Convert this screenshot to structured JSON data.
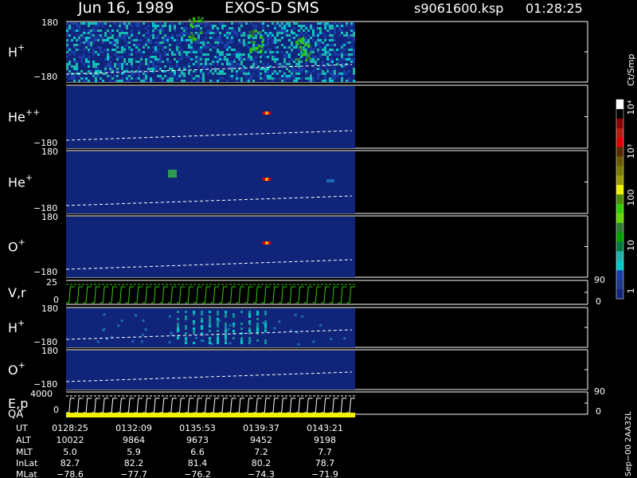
{
  "header": {
    "date": "Jun 16, 1989",
    "instrument": "EXOS-D SMS",
    "file": "s9061600.ksp",
    "time": "01:28:25"
  },
  "panels": [
    {
      "id": "h-plus",
      "ion": "H",
      "charge": "+",
      "ytop": "180",
      "ybot": "−180",
      "type": "spectrogram"
    },
    {
      "id": "he-plusplus",
      "ion": "He",
      "charge": "++",
      "ytop": "",
      "ybot": "−180",
      "type": "spectrogram"
    },
    {
      "id": "he-plus",
      "ion": "He",
      "charge": "+",
      "ytop": "180",
      "ybot": "−180",
      "type": "spectrogram"
    },
    {
      "id": "o-plus",
      "ion": "O",
      "charge": "+",
      "ytop": "180",
      "ybot": "−180",
      "type": "spectrogram"
    },
    {
      "id": "v-r",
      "ion": "V,r",
      "charge": "",
      "ytop": "25",
      "ybot": "0",
      "right_top": "90",
      "right_bot": "0",
      "type": "sawtooth"
    },
    {
      "id": "h-plus-2",
      "ion": "H",
      "charge": "+",
      "ytop": "180",
      "ybot": "−180",
      "type": "spectrogram"
    },
    {
      "id": "o-plus-2",
      "ion": "O",
      "charge": "+",
      "ytop": "180",
      "ybot": "−180",
      "type": "spectrogram"
    },
    {
      "id": "e-p",
      "ion": "E,p",
      "charge": "",
      "ytop": "4000",
      "ybot": "0",
      "right_top": "90",
      "right_bot": "0",
      "type": "sawtooth"
    }
  ],
  "qa_label": "QA",
  "colorbar": {
    "unit": "Ct/Smp",
    "ticks": [
      "10⁴",
      "10³",
      "100",
      "10",
      "1"
    ],
    "colors": [
      "#ffffff",
      "#000000",
      "#8b0000",
      "#b81d12",
      "#e30000",
      "#5a2a00",
      "#6b5a00",
      "#7a7a00",
      "#9a9a00",
      "#f2f200",
      "#4f8e00",
      "#33cc00",
      "#66d600",
      "#2e7d32",
      "#00a000",
      "#007a40",
      "#20b2aa",
      "#00c8c8",
      "#1a3ea8",
      "#1e3a8a",
      "#10257a"
    ]
  },
  "ephemeris": {
    "labels": [
      "UT",
      "ALT",
      "MLT",
      "InLat",
      "MLat"
    ],
    "columns": [
      [
        "0128:25",
        "10022",
        "5.0",
        "82.7",
        "−78.6"
      ],
      [
        "0132:09",
        "9864",
        "5.9",
        "82.2",
        "−77.7"
      ],
      [
        "0135:53",
        "9673",
        "6.6",
        "81.4",
        "−76.2"
      ],
      [
        "0139:37",
        "9452",
        "7.2",
        "80.2",
        "−74.3"
      ],
      [
        "0143:21",
        "9198",
        "7.7",
        "78.7",
        "−71.9"
      ]
    ]
  },
  "footer": "Sep−00  2AA32L",
  "chart_data": {
    "type": "heatmap",
    "title": "Jun 16, 1989   EXOS-D SMS",
    "x": [
      "0128:25",
      "0132:09",
      "0135:53",
      "0139:37",
      "0143:21"
    ],
    "series": [
      {
        "name": "H+",
        "ylim": [
          -180,
          180
        ]
      },
      {
        "name": "He++",
        "ylim": [
          -180,
          180
        ]
      },
      {
        "name": "He+",
        "ylim": [
          -180,
          180
        ]
      },
      {
        "name": "O+",
        "ylim": [
          -180,
          180
        ]
      },
      {
        "name": "V,r",
        "ylim": [
          0,
          25
        ],
        "right_ylim": [
          0,
          90
        ]
      },
      {
        "name": "H+",
        "ylim": [
          -180,
          180
        ]
      },
      {
        "name": "O+",
        "ylim": [
          -180,
          180
        ]
      },
      {
        "name": "E,p",
        "ylim": [
          0,
          4000
        ],
        "right_ylim": [
          0,
          90
        ]
      }
    ],
    "colorbar_unit": "Ct/Smp",
    "colorbar_range": [
      1,
      10000
    ]
  }
}
